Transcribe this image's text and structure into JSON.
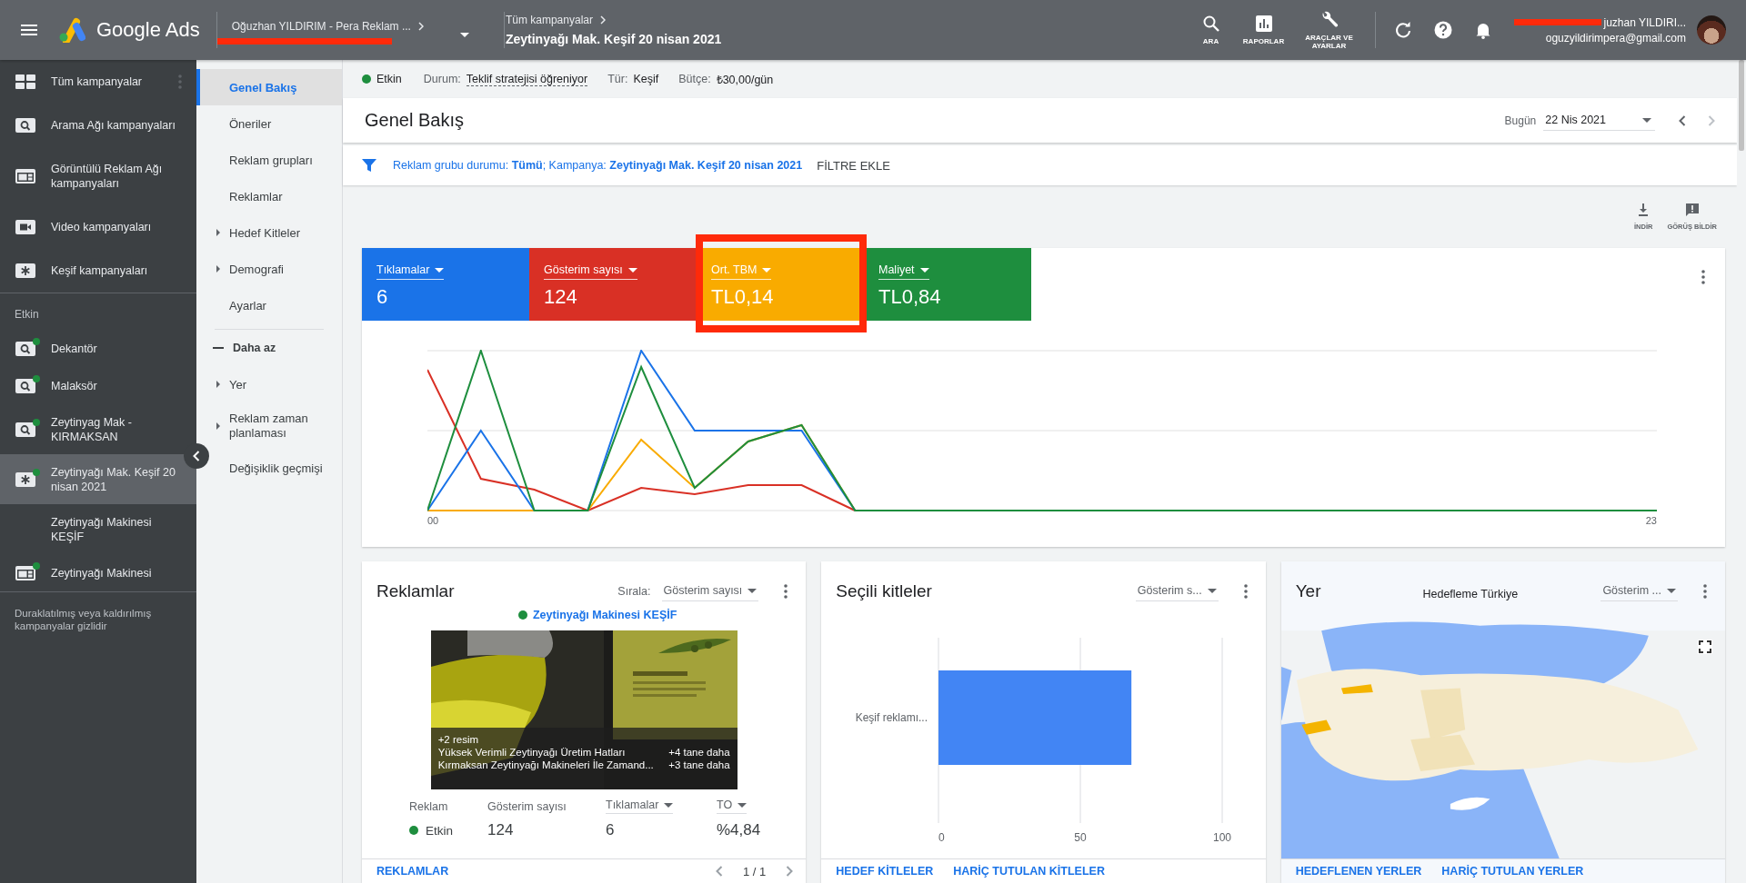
{
  "top_bar": {
    "product": "Google Ads",
    "account": "Oğuzhan YILDIRIM - Pera Reklam ...",
    "breadcrumb_parent": "Tüm kampanyalar",
    "breadcrumb_current": "Zeytinyağı Mak. Keşif 20 nisan 2021",
    "tools": [
      {
        "label": "ARA",
        "kind": "search"
      },
      {
        "label": "RAPORLAR",
        "kind": "reports"
      },
      {
        "label": "ARAÇLAR VE AYARLAR",
        "kind": "tools"
      }
    ],
    "user_name": "juzhan YILDIRI...",
    "user_email": "oguzyildirimpera@gmail.com"
  },
  "campaign_types": [
    {
      "label": "Tüm kampanyalar",
      "kind": "grid"
    },
    {
      "label": "Arama Ağı kampanyaları",
      "kind": "search"
    },
    {
      "label": "Görüntülü Reklam Ağı kampanyaları",
      "kind": "display"
    },
    {
      "label": "Video kampanyaları",
      "kind": "video"
    },
    {
      "label": "Keşif kampanyaları",
      "kind": "discovery"
    }
  ],
  "active_heading": "Etkin",
  "campaigns": [
    {
      "label": "Dekantör",
      "kind": "search",
      "active": true,
      "selected": false
    },
    {
      "label": "Malaksör",
      "kind": "search",
      "active": true,
      "selected": false
    },
    {
      "label": "Zeytinyag Mak - KIRMAKSAN",
      "kind": "search",
      "active": true,
      "selected": false
    },
    {
      "label": "Zeytinyağı Mak. Keşif 20 nisan 2021",
      "kind": "discovery",
      "active": true,
      "selected": true
    },
    {
      "label": "Zeytinyağı Makinesi KEŞİF",
      "kind": "none",
      "active": false,
      "selected": false
    },
    {
      "label": "Zeytinyağı Makinesi",
      "kind": "display",
      "active": true,
      "selected": false
    }
  ],
  "hidden_note": "Duraklatılmış veya kaldırılmış kampanyalar gizlidir",
  "page_nav": {
    "items": [
      {
        "label": "Genel Bakış",
        "selected": true,
        "expandable": false
      },
      {
        "label": "Öneriler",
        "selected": false,
        "expandable": false
      },
      {
        "label": "Reklam grupları",
        "selected": false,
        "expandable": false
      },
      {
        "label": "Reklamlar",
        "selected": false,
        "expandable": false
      },
      {
        "label": "Hedef Kitleler",
        "selected": false,
        "expandable": true
      },
      {
        "label": "Demografi",
        "selected": false,
        "expandable": true
      },
      {
        "label": "Ayarlar",
        "selected": false,
        "expandable": false
      }
    ],
    "less_toggle": "Daha az",
    "more_items": [
      {
        "label": "Yer",
        "selected": false,
        "expandable": true
      },
      {
        "label": "Reklam zaman planlaması",
        "selected": false,
        "expandable": true
      },
      {
        "label": "Değişiklik geçmişi",
        "selected": false,
        "expandable": false
      }
    ]
  },
  "status_strip": {
    "status": "Etkin",
    "fields": [
      {
        "label": "Durum:",
        "value": "Teklif stratejisi öğreniyor",
        "dashed": true
      },
      {
        "label": "Tür:",
        "value": "Keşif",
        "dashed": false
      },
      {
        "label": "Bütçe:",
        "value": "₺30,00/gün",
        "dashed": false
      }
    ]
  },
  "header": {
    "title": "Genel Bakış",
    "date_label": "Bugün",
    "date": "22 Nis 2021"
  },
  "filter": {
    "summary": "Reklam grubu durumu: **Tümü**; Kampanya: **Zeytinyağı Mak. Keşif 20 nisan 2021**",
    "add_filter": "FİLTRE EKLE"
  },
  "actions": [
    {
      "label": "İNDİR",
      "kind": "download"
    },
    {
      "label": "GÖRÜŞ BİLDİR",
      "kind": "feedback"
    }
  ],
  "metrics": [
    {
      "label": "Tıklamalar",
      "value": "6",
      "color": "#1a73e8",
      "highlighted": false
    },
    {
      "label": "Gösterim sayısı",
      "value": "124",
      "color": "#d93025",
      "highlighted": false
    },
    {
      "label": "Ort. TBM",
      "value": "TL0,14",
      "color": "#f9ab00",
      "highlighted": true
    },
    {
      "label": "Maliyet",
      "value": "TL0,84",
      "color": "#1e8e3e",
      "highlighted": false
    }
  ],
  "trend_chart": {
    "x_start": "00",
    "x_end": "23"
  },
  "ads_card": {
    "title": "Reklamlar",
    "sort_label": "Sırala:",
    "sort_value": "Gösterim sayısı",
    "ad_group": "Zeytinyağı Makinesi KEŞİF",
    "image_count": "+2 resim",
    "headlines": [
      {
        "text": "Yüksek Verimli Zeytinyağı Üretim Hatları",
        "more": "+4 tane daha"
      },
      {
        "text": "Kırmaksan Zeytinyağı Makineleri İle Zamand...",
        "more": "+3 tane daha"
      }
    ],
    "columns": [
      {
        "label": "Reklam",
        "sortable": false
      },
      {
        "label": "Gösterim sayısı",
        "sortable": false
      },
      {
        "label": "Tıklamalar",
        "sortable": true
      },
      {
        "label": "TO",
        "sortable": true
      }
    ],
    "row": [
      {
        "text": "Etkin",
        "kind": "status"
      },
      {
        "text": "124",
        "kind": "number"
      },
      {
        "text": "6",
        "kind": "number"
      },
      {
        "text": "%4,84",
        "kind": "number"
      }
    ],
    "footer_link": "REKLAMLAR",
    "pager": "1 / 1"
  },
  "audience_card": {
    "title": "Seçili kitleler",
    "sort_value": "Gösterim s...",
    "chart_data": {
      "type": "bar",
      "orientation": "horizontal",
      "categories": [
        "Keşif reklamı..."
      ],
      "values": [
        68
      ],
      "xlim": [
        0,
        100
      ],
      "xticks": [
        0,
        50,
        100
      ]
    },
    "links": [
      "HEDEF KİTLELER",
      "HARİÇ TUTULAN KİTLELER"
    ]
  },
  "location_card": {
    "title": "Yer",
    "map_caption": "Hedefleme Türkiye",
    "sort_value": "Gösterim ...",
    "links": [
      "HEDEFLENEN YERLER",
      "HARİÇ TUTULAN YERLER"
    ]
  }
}
